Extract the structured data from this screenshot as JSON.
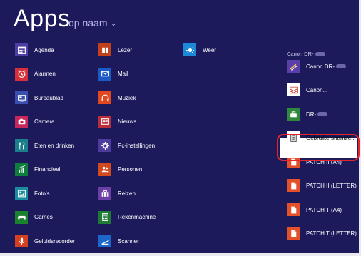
{
  "header": {
    "title": "Apps",
    "sort_label": "op naam",
    "sort_chevron": "⌄"
  },
  "columns": [
    {
      "items": [
        {
          "label": "Agenda",
          "color": "#4f3ea3",
          "icon": "calendar-icon"
        },
        {
          "label": "Alarmen",
          "color": "#d7303a",
          "icon": "alarm-clock-icon"
        },
        {
          "label": "Bureaublad",
          "color": "#3a4fb0",
          "icon": "desktop-icon"
        },
        {
          "label": "Camera",
          "color": "#c8275b",
          "icon": "camera-icon"
        },
        {
          "label": "Eten en drinken",
          "color": "#1a7f8a",
          "icon": "fork-knife-icon"
        },
        {
          "label": "Financieel",
          "color": "#0f7e3d",
          "icon": "chart-icon"
        },
        {
          "label": "Foto's",
          "color": "#1b8da0",
          "icon": "photo-icon"
        },
        {
          "label": "Games",
          "color": "#18822c",
          "icon": "gamepad-icon"
        },
        {
          "label": "Geluidsrecorder",
          "color": "#d44020",
          "icon": "microphone-icon"
        }
      ]
    },
    {
      "items": [
        {
          "label": "Lezer",
          "color": "#c2411d",
          "icon": "reader-icon"
        },
        {
          "label": "Mail",
          "color": "#1c5bc6",
          "icon": "mail-icon"
        },
        {
          "label": "Muziek",
          "color": "#e3471f",
          "icon": "headphones-icon"
        },
        {
          "label": "Nieuws",
          "color": "#b82e3a",
          "icon": "news-icon"
        },
        {
          "label": "Pc-instellingen",
          "color": "#4d3b9e",
          "icon": "gear-icon"
        },
        {
          "label": "Personen",
          "color": "#d0491f",
          "icon": "people-icon"
        },
        {
          "label": "Reizen",
          "color": "#6a3fa6",
          "icon": "suitcase-icon"
        },
        {
          "label": "Rekenmachine",
          "color": "#1e7a36",
          "icon": "calculator-icon"
        },
        {
          "label": "Scanner",
          "color": "#1c67c9",
          "icon": "scanner-icon"
        }
      ]
    },
    {
      "items": [
        {
          "label": "Weer",
          "color": "#1e88d8",
          "icon": "sun-icon"
        }
      ]
    }
  ],
  "group": {
    "header": "Canon DR-",
    "items": [
      {
        "label": "Canon DR-",
        "color": "#5b3fa8",
        "icon": "scanner-app-icon",
        "redacted": true
      },
      {
        "label": "Canon...",
        "color": "#ffffff",
        "icon": "document-stack-icon",
        "redacted": false
      },
      {
        "label": "DR-",
        "color": "#2e8a3a",
        "icon": "scanner-device-icon",
        "redacted": true
      },
      {
        "label": "Gebruikershandle...",
        "color": "#ffffff",
        "icon": "manual-icon",
        "redacted": false,
        "highlighted": true
      },
      {
        "label": "PATCH II (A4)",
        "color": "#e4502a",
        "icon": "pdf-icon",
        "redacted": false
      },
      {
        "label": "PATCH II (LETTER)",
        "color": "#e4502a",
        "icon": "pdf-icon",
        "redacted": false
      },
      {
        "label": "PATCH T (A4)",
        "color": "#e4502a",
        "icon": "pdf-icon",
        "redacted": false
      },
      {
        "label": "PATCH T (LETTER)",
        "color": "#e4502a",
        "icon": "pdf-icon",
        "redacted": false
      }
    ]
  }
}
